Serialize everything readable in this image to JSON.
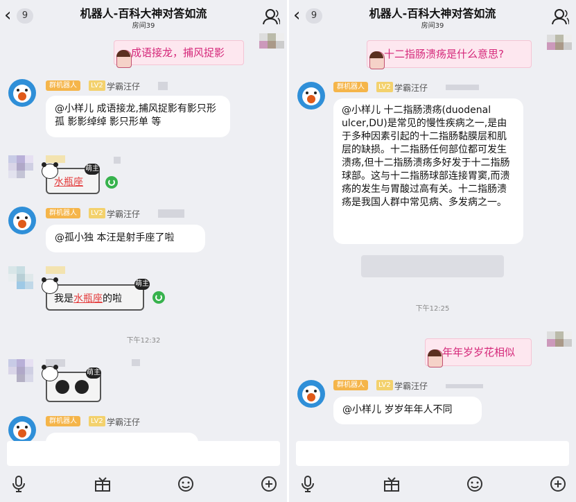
{
  "header": {
    "back_count": "9",
    "title": "机器人-百科大神对答如流",
    "room": "房间39"
  },
  "left": {
    "my_message": "成语接龙，捕风捉影",
    "bot_tag": "群机器人",
    "level": "LV2",
    "bot_name": "学霸汪仔",
    "reply1_mention": "@小样儿",
    "reply1_body": "成语接龙,捕风捉影有影只形孤 影影绰绰 影只形单 等",
    "panda_badge": "萌主",
    "user1_msg_link": "水瓶座",
    "reply2": "@孤小独 本汪是射手座了啦",
    "user2_msg_prefix": "我是",
    "user2_msg_link": "水瓶座",
    "user2_msg_suffix": "的啦",
    "time1": "下午12:32",
    "colors": {
      "pink_text": "#d5287a",
      "bot_blue": "#2f8fd8",
      "tag_orange": "#f5b54a",
      "link_red": "#e33a3a"
    }
  },
  "right": {
    "my_message1": "十二指肠溃疡是什么意思?",
    "bot_tag": "群机器人",
    "level": "LV2",
    "bot_name": "学霸汪仔",
    "reply1": "@小样儿 十二指肠溃疡(duodenal ulcer,DU)是常见的慢性疾病之一,是由于多种因素引起的十二指肠黏膜层和肌层的缺损。十二指肠任何部位都可发生溃疡,但十二指肠溃疡多好发于十二指肠球部。这与十二指肠球部连接胃窦,而溃疡的发生与胃酸过高有关。十二指肠溃疡是我国人群中常见病、多发病之一。",
    "time1": "下午12:25",
    "my_message2": "年年岁岁花相似",
    "reply2": "@小样儿 岁岁年年人不同"
  },
  "toolbar": {
    "icons": [
      "microphone-icon",
      "gift-icon",
      "emoji-icon",
      "plus-icon"
    ]
  }
}
